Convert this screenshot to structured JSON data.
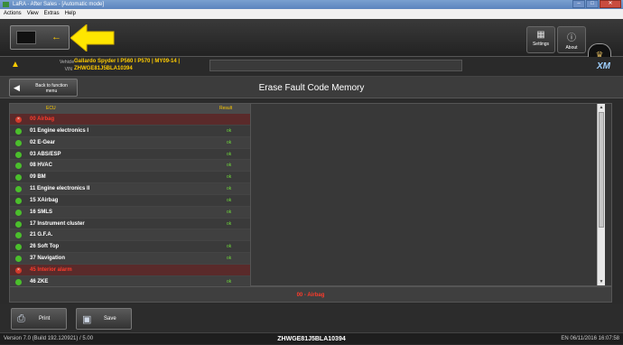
{
  "window": {
    "title": "LaRA - After Sales - [Automatic mode]",
    "controls": [
      "–",
      "□",
      "✕"
    ]
  },
  "menu": [
    "Actions",
    "View",
    "Extras",
    "Help"
  ],
  "toolbar": {
    "settings_label": "Settings",
    "about_label": "About"
  },
  "vehicle": {
    "vehicle_label": "Vehicle",
    "vin_label": "VIN",
    "vehicle_value": "Gallardo Spyder I P560 I P570 | MY09-14 |",
    "vin_value": "ZHWGE81J5BLA10394"
  },
  "header": {
    "back_label": "Back to function menu",
    "title": "Erase Fault Code Memory"
  },
  "table": {
    "col_ecu": "ECU",
    "col_result": "Result",
    "rows": [
      {
        "status": "err",
        "ecu": "00 Airbag",
        "result": ""
      },
      {
        "status": "ok",
        "ecu": "01 Engine electronics I",
        "result": "ok"
      },
      {
        "status": "ok",
        "ecu": "02 E-Gear",
        "result": "ok"
      },
      {
        "status": "ok",
        "ecu": "03 ABS/ESP",
        "result": "ok"
      },
      {
        "status": "ok",
        "ecu": "08 HVAC",
        "result": "ok"
      },
      {
        "status": "ok",
        "ecu": "09 BM",
        "result": "ok"
      },
      {
        "status": "ok",
        "ecu": "11 Engine electronics II",
        "result": "ok"
      },
      {
        "status": "ok",
        "ecu": "15 XAirbag",
        "result": "ok"
      },
      {
        "status": "ok",
        "ecu": "16 SMLS",
        "result": "ok"
      },
      {
        "status": "ok",
        "ecu": "17 Instrument cluster",
        "result": "ok"
      },
      {
        "status": "ok",
        "ecu": "21 G.F.A.",
        "result": ""
      },
      {
        "status": "ok",
        "ecu": "26 Soft Top",
        "result": "ok"
      },
      {
        "status": "ok",
        "ecu": "37 Navigation",
        "result": "ok"
      },
      {
        "status": "err",
        "ecu": "45 Interior alarm",
        "result": ""
      },
      {
        "status": "ok",
        "ecu": "46 ZKE",
        "result": "ok"
      }
    ]
  },
  "summary": "00 - Airbag",
  "actions": {
    "print_label": "Print",
    "save_label": "Save"
  },
  "status": {
    "version": "Version 7.0 (Build 192.120921) / 5.00",
    "vin": "ZHWGE81J5BLA10394",
    "locale_time": "EN  06/11/2016 16:07:58"
  },
  "colors": {
    "accent_yellow": "#ffcc00",
    "ok_green": "#4bbf2c",
    "error_red": "#d23a2a"
  },
  "icons": {
    "back": "arrow-left-icon",
    "settings": "settings-icon",
    "about": "info-icon",
    "print": "printer-icon",
    "save": "floppy-disk-icon"
  }
}
